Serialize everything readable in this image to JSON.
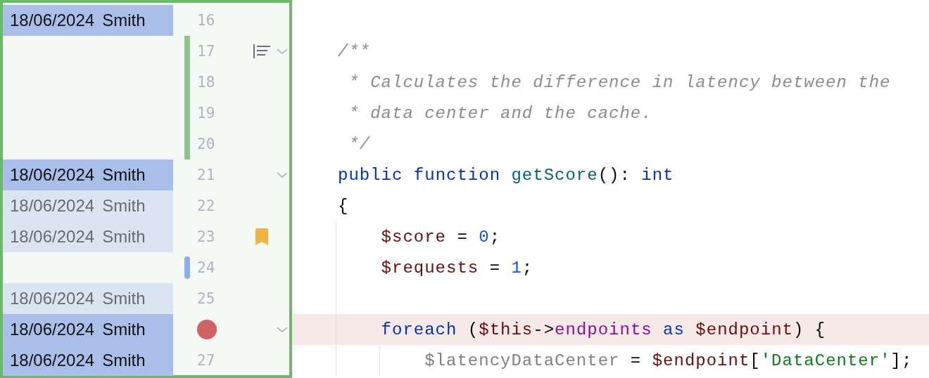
{
  "lines": [
    {
      "number": "16",
      "annotation": {
        "date": "18/06/2024",
        "author": "Smith",
        "kind": "recent"
      }
    },
    {
      "number": "17",
      "added": true,
      "doc_comment": true,
      "foldable": true,
      "tokens": [
        {
          "t": "/**",
          "kind": "comment"
        }
      ]
    },
    {
      "number": "18",
      "added": true,
      "tokens": [
        {
          "t": " * Calculates the difference in latency between the",
          "kind": "comment"
        }
      ]
    },
    {
      "number": "19",
      "added": true,
      "tokens": [
        {
          "t": " * data center and the cache.",
          "kind": "comment"
        }
      ]
    },
    {
      "number": "20",
      "added": true,
      "tokens": [
        {
          "t": " */",
          "kind": "comment"
        }
      ]
    },
    {
      "number": "21",
      "annotation": {
        "date": "18/06/2024",
        "author": "Smith",
        "kind": "recent"
      },
      "foldable": true,
      "tokens": [
        {
          "t": "public ",
          "kind": "keyword"
        },
        {
          "t": "function ",
          "kind": "keyword"
        },
        {
          "t": "getScore",
          "kind": "function"
        },
        {
          "t": "(): ",
          "kind": "punct"
        },
        {
          "t": "int",
          "kind": "keyword"
        }
      ]
    },
    {
      "number": "22",
      "annotation": {
        "date": "18/06/2024",
        "author": "Smith",
        "kind": "older"
      },
      "tokens": [
        {
          "t": "{",
          "kind": "punct"
        }
      ]
    },
    {
      "number": "23",
      "annotation": {
        "date": "18/06/2024",
        "author": "Smith",
        "kind": "older"
      },
      "bookmarked": true,
      "tokens": [
        {
          "t": "    $score",
          "kind": "variable"
        },
        {
          "t": " = ",
          "kind": "punct"
        },
        {
          "t": "0",
          "kind": "number"
        },
        {
          "t": ";",
          "kind": "punct"
        }
      ]
    },
    {
      "number": "24",
      "modified": true,
      "tokens": [
        {
          "t": "    $requests",
          "kind": "variable"
        },
        {
          "t": " = ",
          "kind": "punct"
        },
        {
          "t": "1",
          "kind": "number"
        },
        {
          "t": ";",
          "kind": "punct"
        }
      ]
    },
    {
      "number": "25",
      "annotation": {
        "date": "18/06/2024",
        "author": "Smith",
        "kind": "older"
      }
    },
    {
      "breakpoint": true,
      "annotation": {
        "date": "18/06/2024",
        "author": "Smith",
        "kind": "recent"
      },
      "foldable": true,
      "highlighted": true,
      "tokens": [
        {
          "t": "    foreach",
          "kind": "keyword"
        },
        {
          "t": " (",
          "kind": "punct"
        },
        {
          "t": "$this",
          "kind": "variable"
        },
        {
          "t": "->",
          "kind": "punct"
        },
        {
          "t": "endpoints ",
          "kind": "field"
        },
        {
          "t": "as ",
          "kind": "keyword"
        },
        {
          "t": "$endpoint",
          "kind": "variable"
        },
        {
          "t": ") {",
          "kind": "punct"
        }
      ]
    },
    {
      "number": "27",
      "annotation": {
        "date": "18/06/2024",
        "author": "Smith",
        "kind": "recent"
      },
      "tokens": [
        {
          "t": "        $latencyDataCenter",
          "kind": "unused"
        },
        {
          "t": " = ",
          "kind": "punct"
        },
        {
          "t": "$endpoint",
          "kind": "variable"
        },
        {
          "t": "[",
          "kind": "punct"
        },
        {
          "t": "'DataCenter'",
          "kind": "string"
        },
        {
          "t": "];",
          "kind": "punct"
        }
      ]
    }
  ]
}
